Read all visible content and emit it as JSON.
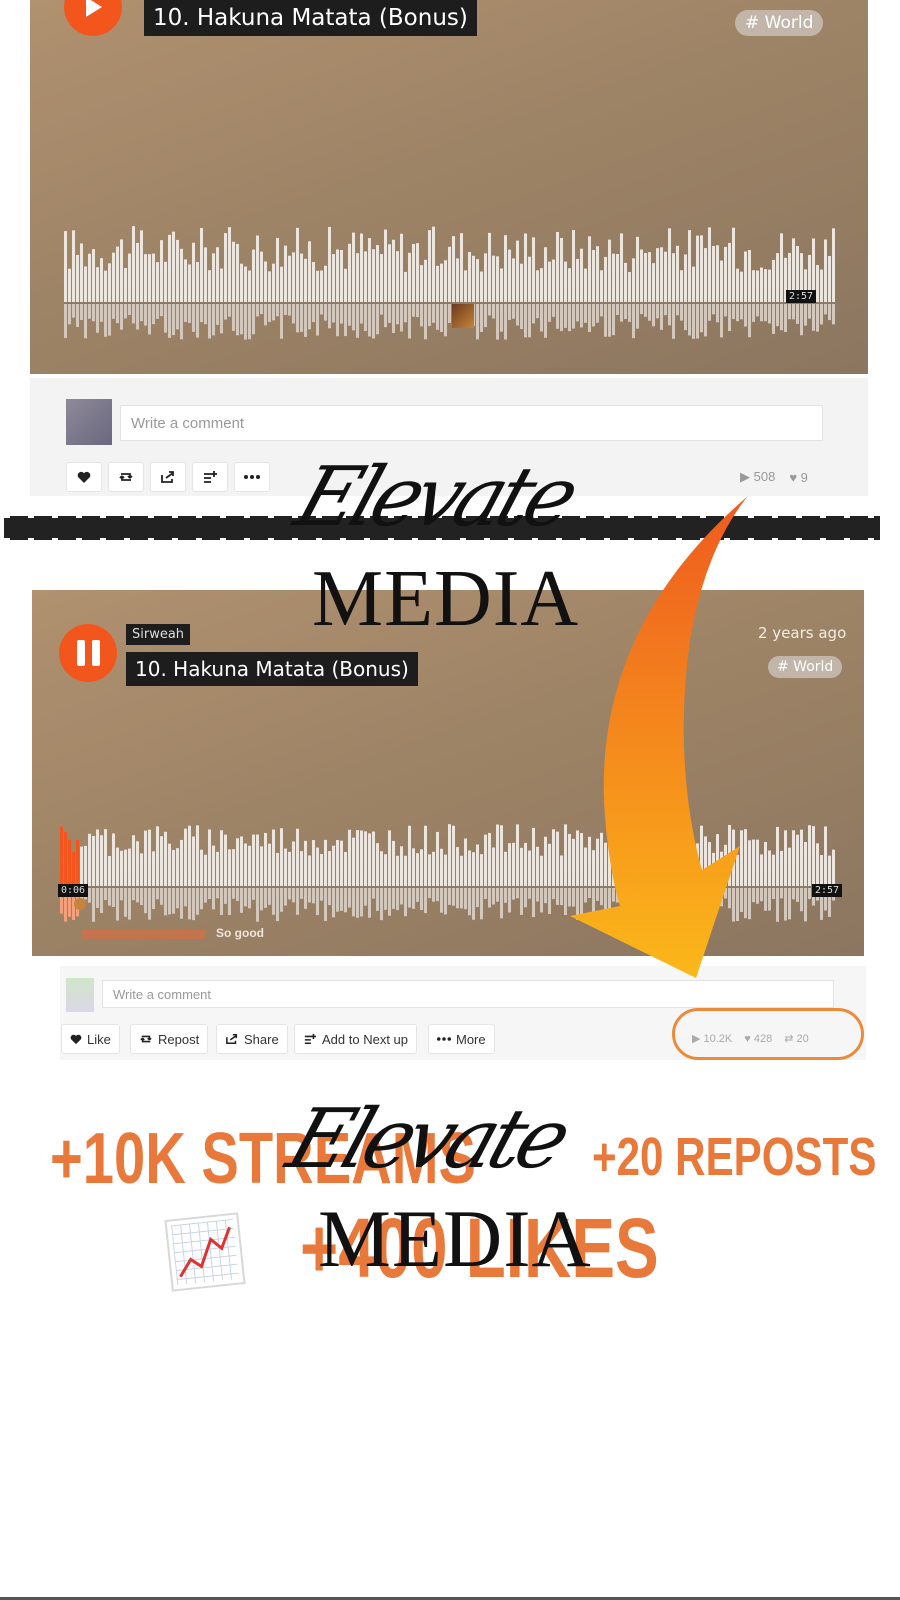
{
  "top_player": {
    "title": "10. Hakuna Matata (Bonus)",
    "tag": "# World",
    "duration": "2:57",
    "comment_placeholder": "Write a comment",
    "stats": {
      "plays": "508",
      "likes": "9"
    }
  },
  "watermark": {
    "script": "Elevate",
    "word": "MEDIA"
  },
  "bottom_player": {
    "artist": "Sirweah",
    "title": "10. Hakuna Matata (Bonus)",
    "posted": "2 years ago",
    "tag": "# World",
    "current_time": "0:06",
    "duration": "2:57",
    "comment_text": "So good",
    "comment_placeholder": "Write a comment",
    "actions": {
      "like": "Like",
      "repost": "Repost",
      "share": "Share",
      "add_next": "Add to Next up",
      "more": "More"
    },
    "stats": {
      "plays": "10.2K",
      "likes": "428",
      "reposts": "20"
    }
  },
  "promo": {
    "streams": "+10K STREAMS",
    "reposts": "+20 REPOSTS",
    "likes": "+400 LIKES"
  },
  "colors": {
    "accent": "#f2561d",
    "promo_orange": "#e8793a",
    "arrow_top": "#ee5a1f",
    "arrow_bottom": "#fbb81a"
  }
}
